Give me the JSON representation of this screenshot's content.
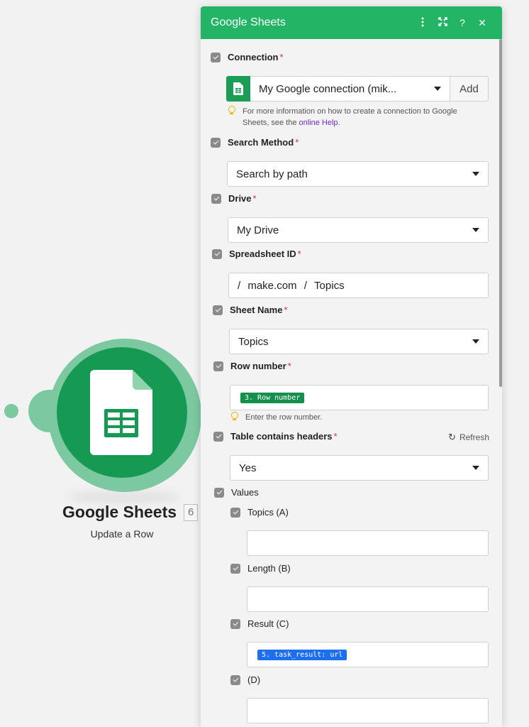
{
  "module": {
    "title": "Google Sheets",
    "badge": "6",
    "subtitle": "Update a Row"
  },
  "panel": {
    "title": "Google Sheets",
    "icons": [
      "more-vertical-icon",
      "expand-icon",
      "help-icon",
      "close-icon"
    ]
  },
  "fields": {
    "connection": {
      "label": "Connection",
      "value": "My Google connection (mik...",
      "add_label": "Add",
      "hint_prefix": "For more information on how to create a connection to Google Sheets, see the ",
      "hint_link": "online Help",
      "hint_suffix": "."
    },
    "search_method": {
      "label": "Search Method",
      "value": "Search by path"
    },
    "drive": {
      "label": "Drive",
      "value": "My Drive"
    },
    "spreadsheet_id": {
      "label": "Spreadsheet ID",
      "path1": "make.com",
      "path2": "Topics",
      "separator": "/"
    },
    "sheet_name": {
      "label": "Sheet Name",
      "value": "Topics"
    },
    "row_number": {
      "label": "Row number",
      "pill": "3. Row number",
      "hint": "Enter the row number."
    },
    "table_headers": {
      "label": "Table contains headers",
      "value": "Yes",
      "refresh_label": "Refresh"
    },
    "values": {
      "label": "Values",
      "topics": {
        "label": "Topics (A)",
        "value": ""
      },
      "length": {
        "label": "Length (B)",
        "value": ""
      },
      "result": {
        "label": "Result (C)",
        "pill": "5. task_result: url"
      },
      "d": {
        "label": "(D)",
        "value": ""
      }
    }
  },
  "required_mark": "*",
  "colors": {
    "header_green": "#23b466",
    "module_green": "#169a53",
    "halo_green": "#7cc8a0",
    "pill_green": "#13904c",
    "pill_blue": "#1e6ef0",
    "required_red": "#e02b2b",
    "link_purple": "#6b2cd2"
  }
}
